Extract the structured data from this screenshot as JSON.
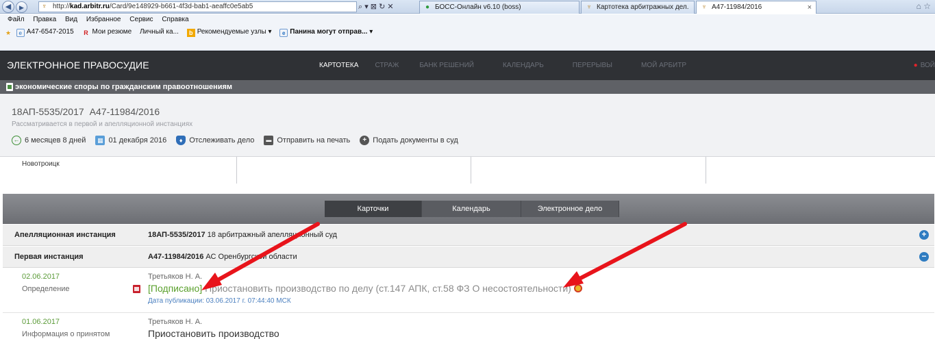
{
  "browser": {
    "address_prefix": "http://",
    "address_host": "kad.arbitr.ru",
    "address_path": "/Card/9e148929-b661-4f3d-bab1-aeaffc0e5ab5",
    "address_tools": "⌕ ▾ ⊠ ↻ ✕",
    "tabs": [
      {
        "label": "БОСС-Онлайн v6.10 (boss)"
      },
      {
        "label": "Картотека арбитражных дел."
      },
      {
        "label": "А47-11984/2016"
      }
    ],
    "menu": [
      "Файл",
      "Правка",
      "Вид",
      "Избранное",
      "Сервис",
      "Справка"
    ],
    "favorites": [
      {
        "label": "А47-6547-2015"
      },
      {
        "label": "Мои резюме"
      },
      {
        "label": "Личный ка..."
      },
      {
        "label": "Рекомендуемые узлы ▾"
      },
      {
        "label": "Панина могут отправ... ▾"
      }
    ]
  },
  "site": {
    "brand": "ЭЛЕКТРОННОЕ ПРАВОСУДИЕ",
    "nav": [
      {
        "label": "КАРТОТЕКА"
      },
      {
        "label": "СТРАЖ"
      },
      {
        "label": "БАНК РЕШЕНИЙ"
      },
      {
        "label": "КАЛЕНДАРЬ"
      },
      {
        "label": "ПЕРЕРЫВЫ"
      },
      {
        "label": "МОЙ АРБИТР"
      }
    ],
    "login": "ВОЙ",
    "category": "экономические споры по гражданским правоотношениям"
  },
  "case": {
    "number_appeal": "18АП-5535/2017",
    "number_first": "А47-11984/2016",
    "status": "Рассматривается в первой и апелляционной инстанциях",
    "actions": [
      {
        "label": "6 месяцев 8 дней"
      },
      {
        "label": "01 декабря 2016"
      },
      {
        "label": "Отслеживать дело"
      },
      {
        "label": "Отправить на печать"
      },
      {
        "label": "Подать документы в суд"
      }
    ],
    "party_city": "Новотроицк"
  },
  "card_tabs": [
    {
      "label": "Карточки"
    },
    {
      "label": "Календарь"
    },
    {
      "label": "Электронное дело"
    }
  ],
  "instances": [
    {
      "label": "Апелляционная инстанция",
      "number": "18АП-5535/2017",
      "court": " 18 арбитражный апелляционный суд",
      "toggle": "+"
    },
    {
      "label": "Первая инстанция",
      "number": "А47-11984/2016",
      "court": " АС Оренбургской области",
      "toggle": "−"
    }
  ],
  "documents": [
    {
      "date": "02.06.2017",
      "type": "Определение",
      "judge": "Третьяков Н. А.",
      "signed": "[Подписано]",
      "text": " Приостановить производство по делу (ст.147 АПК, ст.58 ФЗ О несостоятельности)",
      "published": "Дата публикации: 03.06.2017 г. 07:44:40 МСК"
    },
    {
      "date": "01.06.2017",
      "type": "Информация о принятом",
      "judge": "Третьяков Н. А.",
      "text": "Приостановить производство"
    }
  ],
  "colors": {
    "header_bg": "#2f3135",
    "signed_green": "#5aa02c",
    "arrow_red": "#e8141b",
    "link_blue": "#4a7fbf"
  }
}
